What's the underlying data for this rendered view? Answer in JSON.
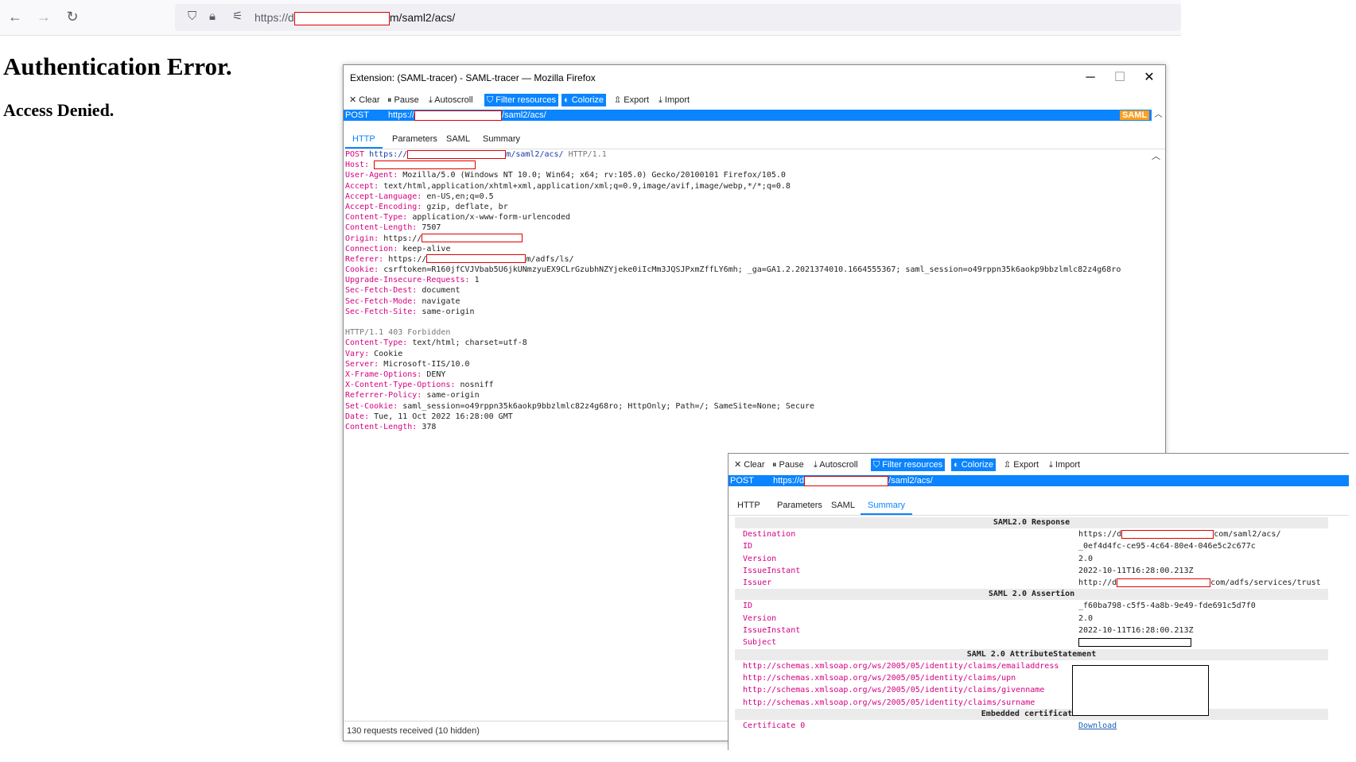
{
  "browser": {
    "url_prefix": "https://d",
    "url_suffix": "m/saml2/acs/"
  },
  "page": {
    "heading": "Authentication Error.",
    "subheading": "Access Denied."
  },
  "tracer": {
    "title": "Extension: (SAML-tracer) - SAML-tracer — Mozilla Firefox",
    "toolbar": {
      "clear": "✕ Clear",
      "pause": "⏸ Pause",
      "autoscroll": "⤓ Autoscroll",
      "filter": "⛉ Filter resources",
      "colorize": "◐ Colorize",
      "export": "⇫ Export",
      "import": "⤓ Import"
    },
    "request": {
      "method": "POST",
      "url_prefix": "https://",
      "url_suffix": "/saml2/acs/",
      "badge": "SAML"
    },
    "tabs": [
      "HTTP",
      "Parameters",
      "SAML",
      "Summary"
    ],
    "http": {
      "request_line": {
        "method": "POST",
        "url_prefix": "https://",
        "url_suffix": "m/saml2/acs/",
        "version": "HTTP/1.1"
      },
      "request_headers": [
        {
          "k": "Host:",
          "v": ""
        },
        {
          "k": "User-Agent:",
          "v": "Mozilla/5.0 (Windows NT 10.0; Win64; x64; rv:105.0) Gecko/20100101 Firefox/105.0"
        },
        {
          "k": "Accept:",
          "v": "text/html,application/xhtml+xml,application/xml;q=0.9,image/avif,image/webp,*/*;q=0.8"
        },
        {
          "k": "Accept-Language:",
          "v": "en-US,en;q=0.5"
        },
        {
          "k": "Accept-Encoding:",
          "v": "gzip, deflate, br"
        },
        {
          "k": "Content-Type:",
          "v": "application/x-www-form-urlencoded"
        },
        {
          "k": "Content-Length:",
          "v": "7507"
        },
        {
          "k": "Origin:",
          "v": "https://"
        },
        {
          "k": "Connection:",
          "v": "keep-alive"
        },
        {
          "k": "Referer:",
          "v": "https://",
          "tail": "m/adfs/ls/"
        },
        {
          "k": "Cookie:",
          "v": "csrftoken=R160jfCVJVbab5U6jkUNmzyuEX9CLrGzubhNZYjeke0iIcMm3JQSJPxmZffLY6mh; _ga=GA1.2.2021374010.1664555367; saml_session=o49rppn35k6aokp9bbzlmlc82z4g68ro"
        },
        {
          "k": "Upgrade-Insecure-Requests:",
          "v": "1"
        },
        {
          "k": "Sec-Fetch-Dest:",
          "v": "document"
        },
        {
          "k": "Sec-Fetch-Mode:",
          "v": "navigate"
        },
        {
          "k": "Sec-Fetch-Site:",
          "v": "same-origin"
        }
      ],
      "status_line": "HTTP/1.1 403 Forbidden",
      "response_headers": [
        {
          "k": "Content-Type:",
          "v": "text/html; charset=utf-8"
        },
        {
          "k": "Vary:",
          "v": "Cookie"
        },
        {
          "k": "Server:",
          "v": "Microsoft-IIS/10.0"
        },
        {
          "k": "X-Frame-Options:",
          "v": "DENY"
        },
        {
          "k": "X-Content-Type-Options:",
          "v": "nosniff"
        },
        {
          "k": "Referrer-Policy:",
          "v": "same-origin"
        },
        {
          "k": "Set-Cookie:",
          "v": "saml_session=o49rppn35k6aokp9bbzlmlc82z4g68ro; HttpOnly; Path=/; SameSite=None; Secure"
        },
        {
          "k": "Date:",
          "v": "Tue, 11 Oct 2022 16:28:00 GMT"
        },
        {
          "k": "Content-Length:",
          "v": "378"
        }
      ]
    },
    "status": "130 requests received (10 hidden)"
  },
  "tracer2": {
    "request": {
      "method": "POST",
      "url_prefix": "https://d",
      "url_suffix": "/saml2/acs/"
    },
    "summary": {
      "response_title": "SAML2.0 Response",
      "response": [
        {
          "k": "Destination",
          "v": "https://d",
          "tail": "com/saml2/acs/"
        },
        {
          "k": "ID",
          "v": "_0ef4d4fc-ce95-4c64-80e4-046e5c2c677c"
        },
        {
          "k": "Version",
          "v": "2.0"
        },
        {
          "k": "IssueInstant",
          "v": "2022-10-11T16:28:00.213Z"
        },
        {
          "k": "Issuer",
          "v": "http://d",
          "tail": "com/adfs/services/trust"
        }
      ],
      "assertion_title": "SAML 2.0 Assertion",
      "assertion": [
        {
          "k": "ID",
          "v": "_f60ba798-c5f5-4a8b-9e49-fde691c5d7f0"
        },
        {
          "k": "Version",
          "v": "2.0"
        },
        {
          "k": "IssueInstant",
          "v": "2022-10-11T16:28:00.213Z"
        },
        {
          "k": "Subject",
          "v": ""
        }
      ],
      "attributes_title": "SAML 2.0 AttributeStatement",
      "attributes": [
        "http://schemas.xmlsoap.org/ws/2005/05/identity/claims/emailaddress",
        "http://schemas.xmlsoap.org/ws/2005/05/identity/claims/upn",
        "http://schemas.xmlsoap.org/ws/2005/05/identity/claims/givenname",
        "http://schemas.xmlsoap.org/ws/2005/05/identity/claims/surname"
      ],
      "certs_title": "Embedded certificates",
      "cert_key": "Certificate 0",
      "cert_link": "Download"
    }
  },
  "colors": {
    "accent": "#0a84ff",
    "header_key": "#d50080",
    "redaction": "#e00000",
    "saml_badge": "#ff9f1c"
  }
}
